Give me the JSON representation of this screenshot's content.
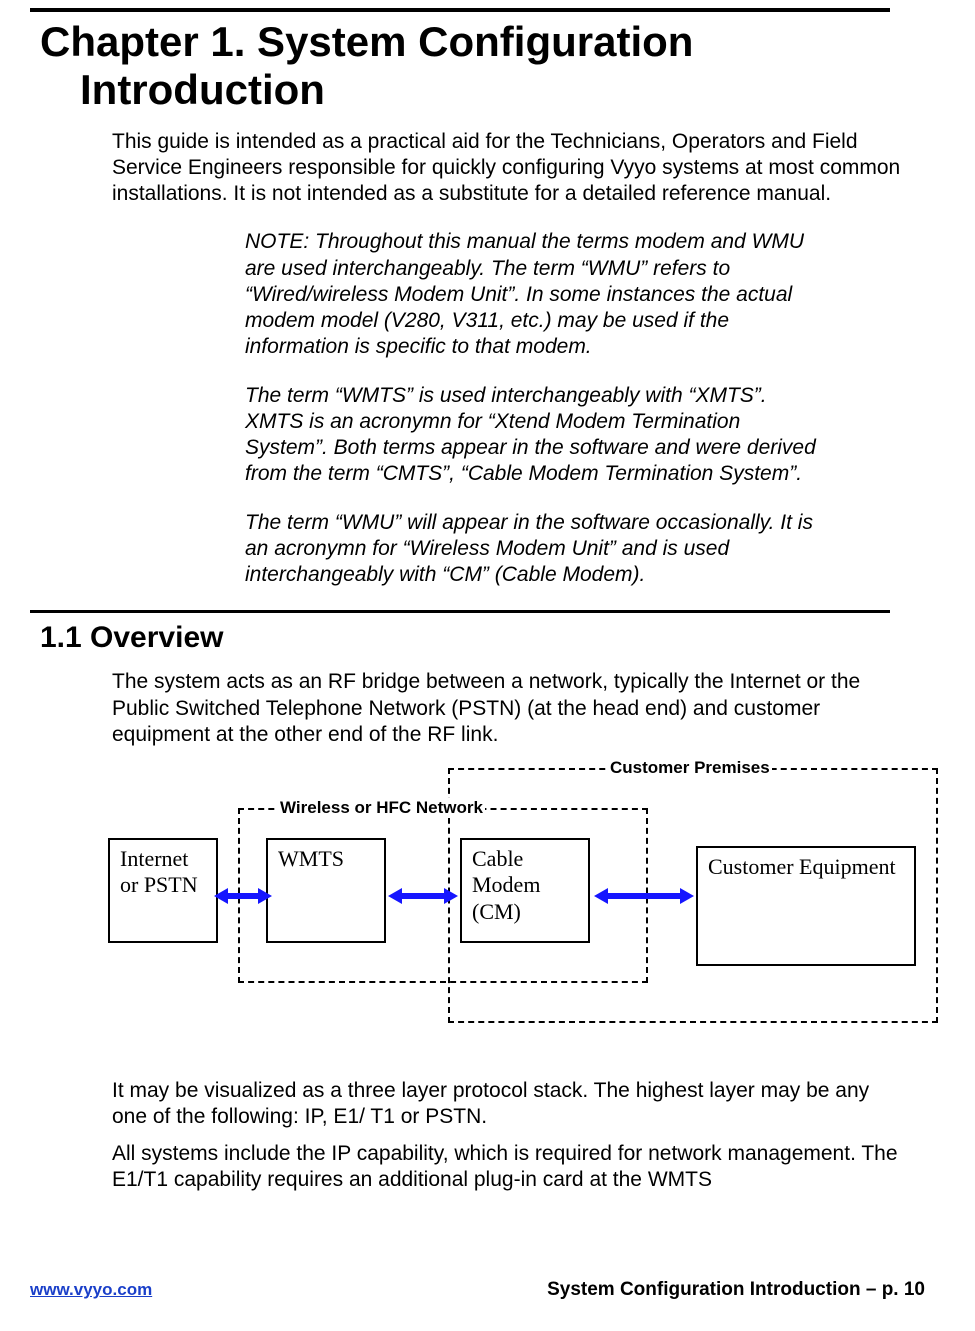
{
  "chapter": {
    "line1": "Chapter 1. System Configuration",
    "line2": "Introduction"
  },
  "intro": "This guide is intended as a practical aid for the Technicians, Operators and Field Service Engineers responsible for quickly configuring Vyyo systems at most common installations. It is not intended as a substitute for a detailed reference manual.",
  "note": {
    "p1": "NOTE:  Throughout this manual the terms modem and WMU are used interchangeably.   The term “WMU” refers to “Wired/wireless Modem Unit”.  In some instances the actual modem model (V280, V311, etc.) may be used if the information is specific to that modem.",
    "p2": " The term “WMTS” is used interchangeably with “XMTS”. XMTS is an acronymn for “Xtend Modem Termination System”.  Both terms appear in the software and were derived from the term “CMTS”, “Cable Modem Termination System”.",
    "p3": "The term “WMU” will appear in the software occasionally. It is an acronymn for “Wireless Modem Unit” and is used interchangeably with “CM” (Cable Modem)."
  },
  "section": {
    "heading": "1.1  Overview",
    "p1": "The system acts as an RF bridge between a network, typically the Internet or the Public Switched Telephone Network (PSTN) (at the head end) and customer equipment at the other end of the RF link.",
    "p2": "It may be visualized as a three layer protocol stack. The highest layer may be any one of the following: IP, E1/ T1 or PSTN.",
    "p3": "All systems include the IP capability, which is required for network management. The E1/T1 capability requires an additional plug-in card at the WMTS"
  },
  "diagram": {
    "customer_premises_label": "Customer Premises",
    "wireless_label": "Wireless or HFC Network",
    "node_internet": "Internet or PSTN",
    "node_wmts": "WMTS",
    "node_cm": "Cable Modem (CM)",
    "node_customer": "Customer Equipment"
  },
  "footer": {
    "url": "www.vyyo.com",
    "right": "System Configuration Introduction – p. 10"
  }
}
